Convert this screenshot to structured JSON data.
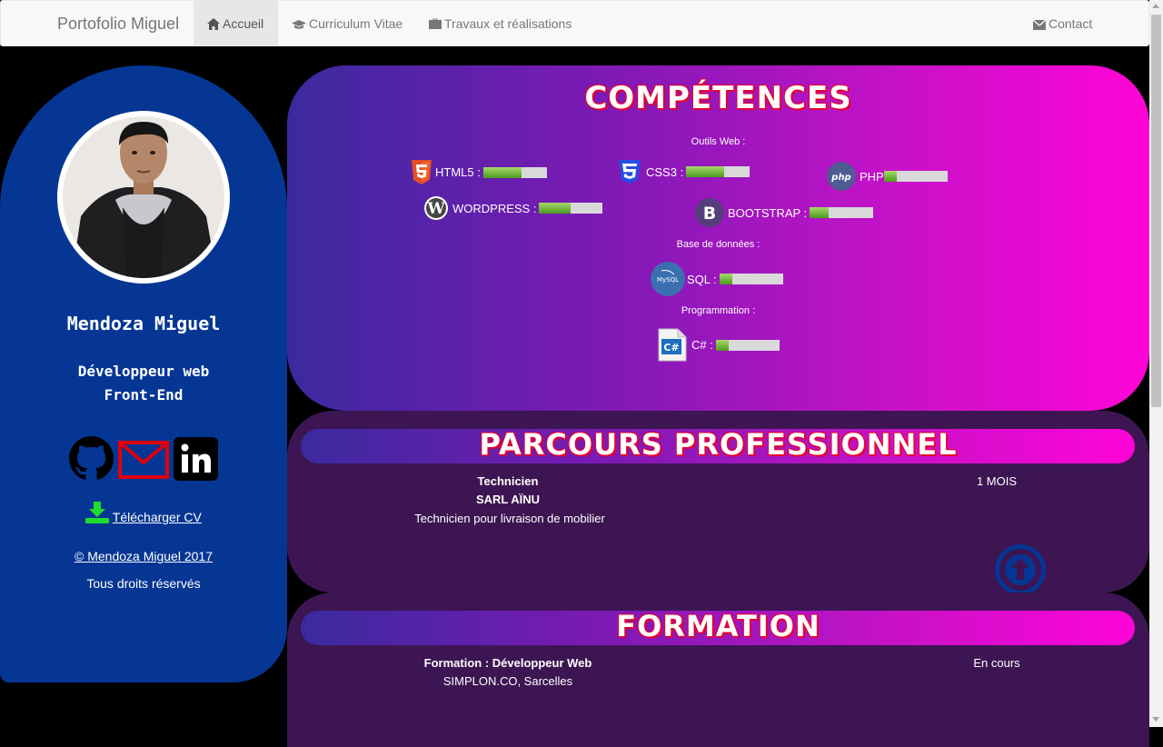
{
  "navbar": {
    "brand": "Portofolio Miguel",
    "items": [
      {
        "label": "Accueil",
        "icon": "home-icon",
        "active": true
      },
      {
        "label": "Curriculum Vitae",
        "icon": "graduation-cap-icon",
        "active": false
      },
      {
        "label": "Travaux et réalisations",
        "icon": "briefcase-icon",
        "active": false
      }
    ],
    "contact": {
      "label": "Contact",
      "icon": "envelope-icon"
    }
  },
  "sidebar": {
    "name": "Mendoza Miguel",
    "job_line1": "Développeur web",
    "job_line2": "Front-End",
    "social": [
      "github-icon",
      "mail-icon",
      "linkedin-icon"
    ],
    "download": "Télécharger CV",
    "copyright_symbol": "©",
    "copyright": " Mendoza Miguel 2017",
    "rights": "Tous droits réservés"
  },
  "competences": {
    "title": "COMPÉTENCES",
    "web_label": "Outils Web :",
    "db_label": "Base de données :",
    "prog_label": "Programmation :",
    "skills": [
      {
        "name": "HTML5 :",
        "icon": "html5-icon",
        "level": 0.6
      },
      {
        "name": "CSS3 :",
        "icon": "css3-icon",
        "level": 0.6
      },
      {
        "name": "PHP",
        "icon": "php-icon",
        "level": 0.2
      },
      {
        "name": "WORDPRESS :",
        "icon": "wordpress-icon",
        "level": 0.5
      },
      {
        "name": "BOOTSTRAP :",
        "icon": "bootstrap-icon",
        "level": 0.3
      },
      {
        "name": "SQL :",
        "icon": "mysql-icon",
        "level": 0.2
      },
      {
        "name": "C# :",
        "icon": "csharp-file-icon",
        "level": 0.2
      }
    ]
  },
  "parcours": {
    "title": "PARCOURS PROFESSIONNEL",
    "job_title": "Technicien",
    "company": "SARL AÏNU",
    "description": "Technicien pour livraison de mobilier",
    "duration": "1 MOIS"
  },
  "formation": {
    "title": "FORMATION",
    "name": "Formation : Développeur Web",
    "school": "SIMPLON.CO, Sarcelles",
    "status": "En cours"
  },
  "colors": {
    "sidebar": "#053694",
    "gradient_start": "#3a2a9e",
    "gradient_end": "#ff04d6",
    "panel_dark": "#3d1552",
    "title_outline": "#e4002b"
  }
}
